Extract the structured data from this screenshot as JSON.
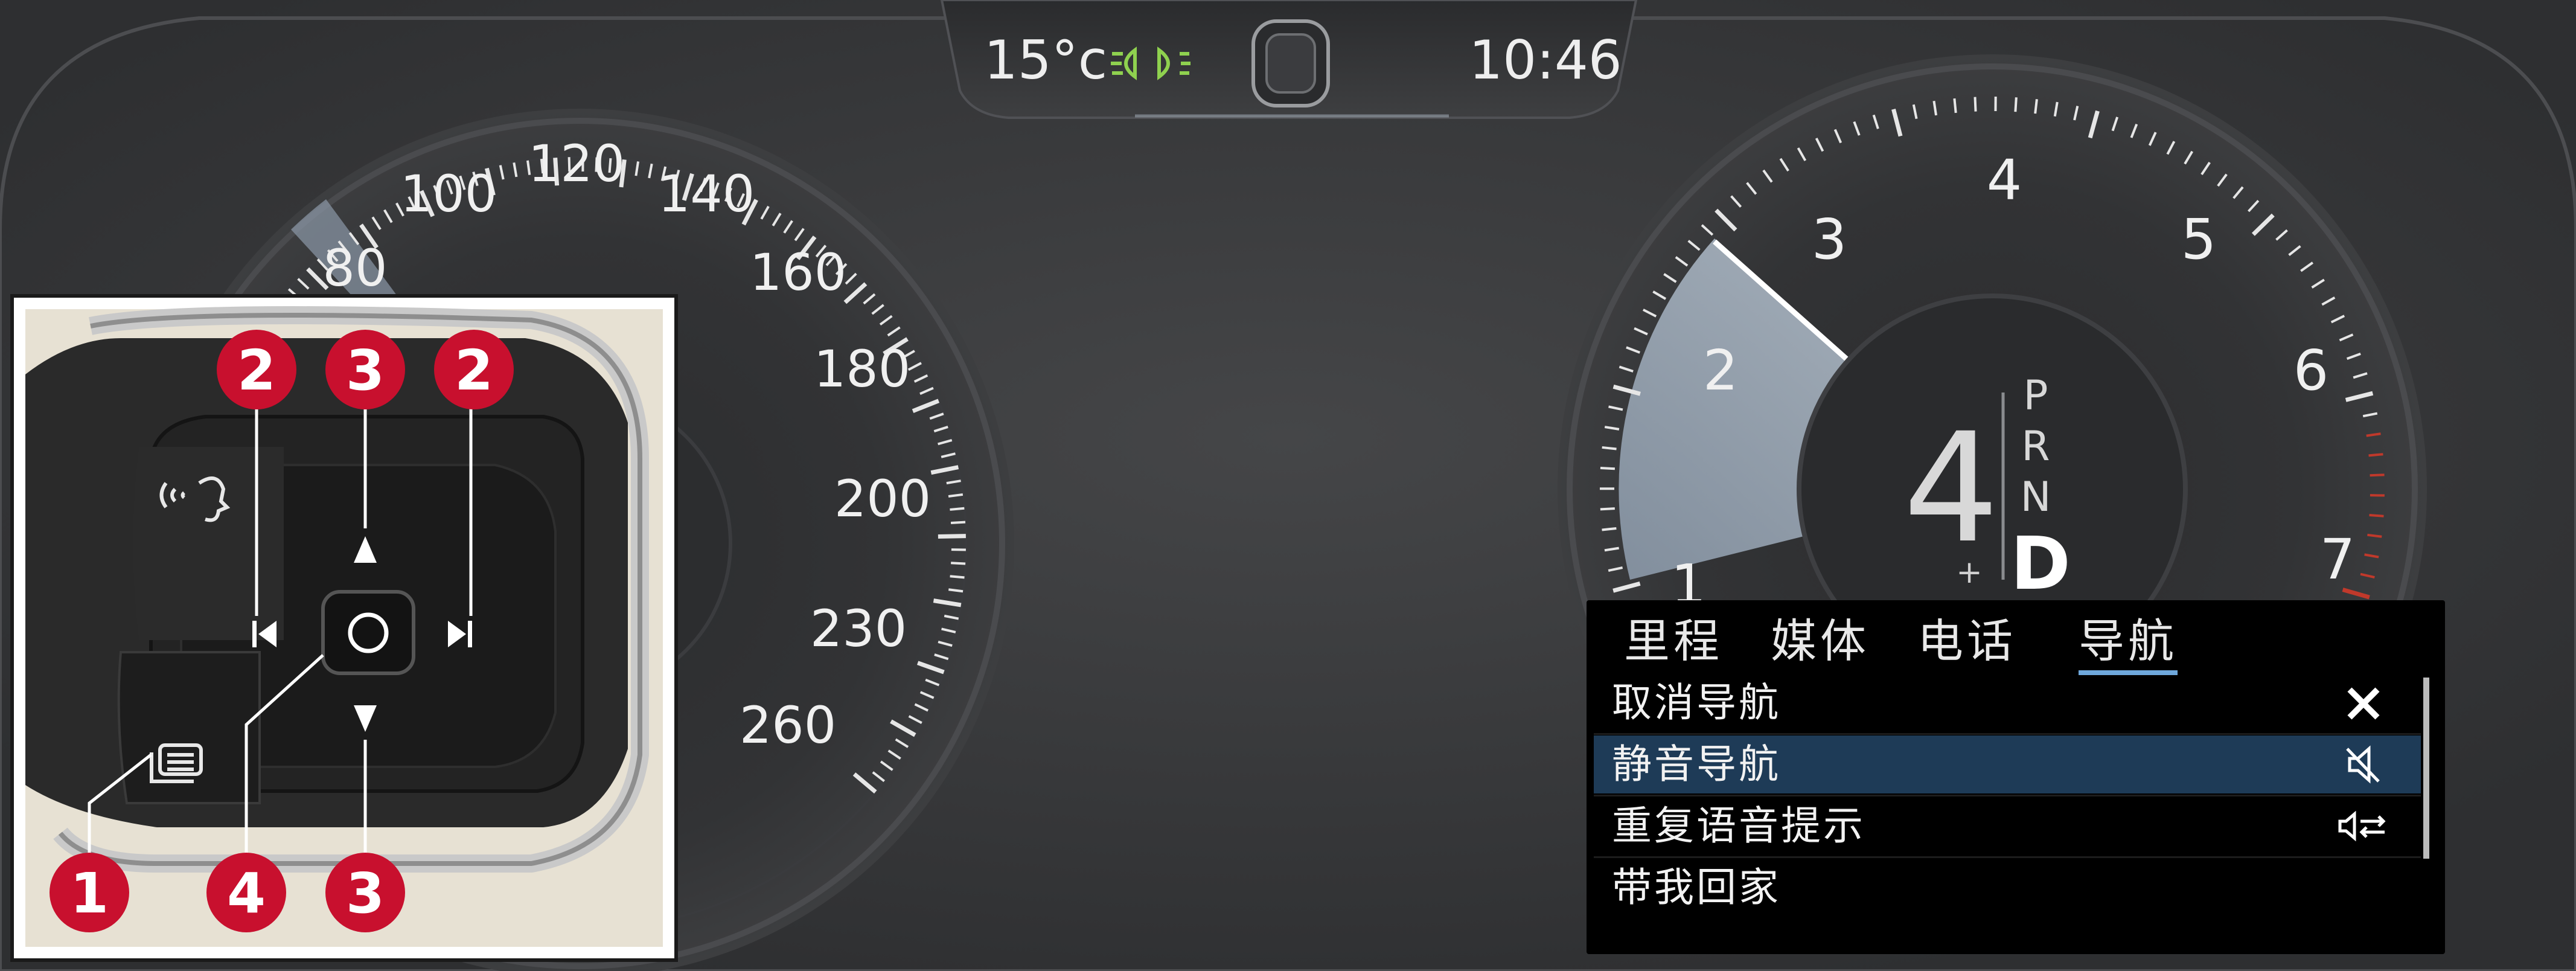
{
  "status_bar": {
    "temperature": "15°c",
    "clock": "10:46",
    "lights_icon": "headlight-indicator-icon"
  },
  "speedometer": {
    "labels": [
      "80",
      "100",
      "120",
      "140",
      "160",
      "180",
      "200",
      "230",
      "260"
    ]
  },
  "tachometer": {
    "labels": [
      "1",
      "2",
      "3",
      "4",
      "5",
      "6",
      "7"
    ],
    "gear_number": "4",
    "gears": [
      "P",
      "R",
      "N",
      "D"
    ],
    "selected_gear": "D",
    "plus_label": "+",
    "minus_label": "–"
  },
  "menu": {
    "tabs": [
      {
        "label": "里程"
      },
      {
        "label": "媒体"
      },
      {
        "label": "电话"
      },
      {
        "label": "导航",
        "active": true
      }
    ],
    "items": [
      {
        "label": "取消导航",
        "icon": "close-icon"
      },
      {
        "label": "静音导航",
        "icon": "mute-icon",
        "selected": true
      },
      {
        "label": "重复语音提示",
        "icon": "repeat-voice-icon"
      },
      {
        "label": "带我回家",
        "icon": ""
      }
    ]
  },
  "steering_inset": {
    "callouts": [
      "2",
      "3",
      "2",
      "1",
      "4",
      "3"
    ],
    "icons": [
      "voice-control-icon",
      "menu-app-icon",
      "previous-icon",
      "next-icon",
      "up-arrow-icon",
      "down-arrow-icon",
      "confirm-button-icon"
    ]
  },
  "colors": {
    "callout_red": "#c8102e",
    "menu_highlight": "#1e3b57",
    "indicator_green": "#8fd14f",
    "redline": "#c0392b"
  }
}
